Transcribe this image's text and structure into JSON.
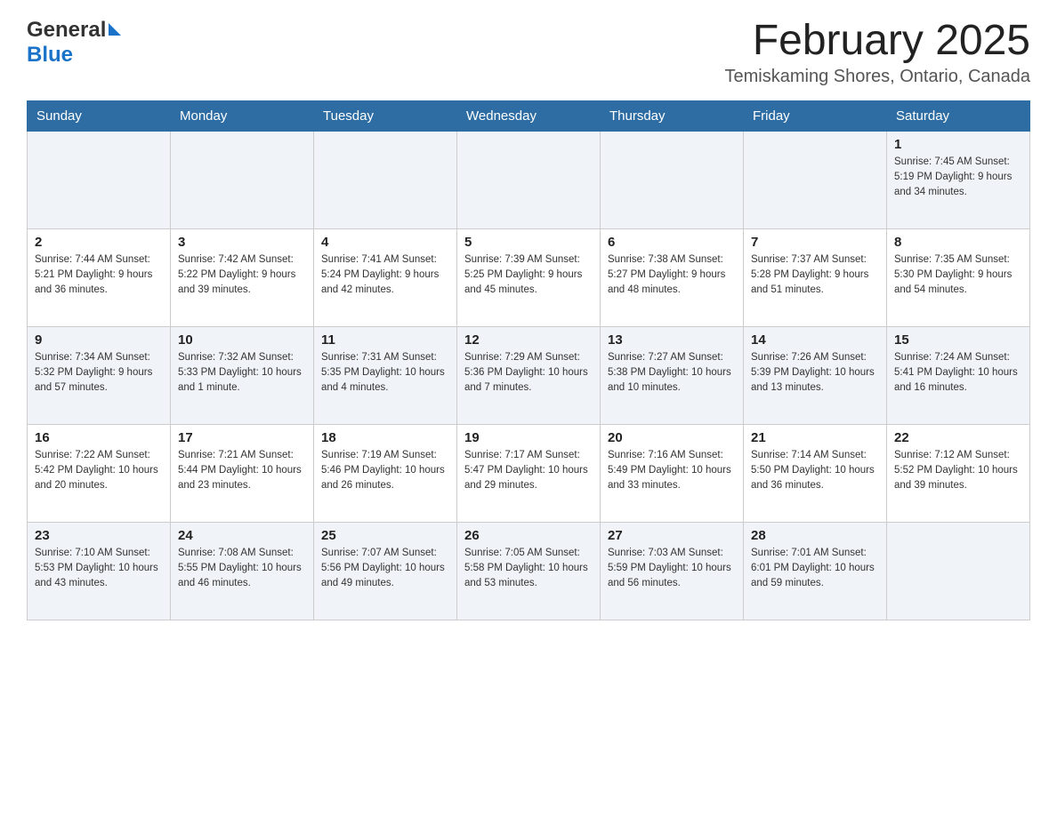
{
  "logo": {
    "text_general": "General",
    "text_blue": "Blue"
  },
  "header": {
    "month_year": "February 2025",
    "location": "Temiskaming Shores, Ontario, Canada"
  },
  "days_of_week": [
    "Sunday",
    "Monday",
    "Tuesday",
    "Wednesday",
    "Thursday",
    "Friday",
    "Saturday"
  ],
  "weeks": [
    [
      {
        "day": "",
        "info": ""
      },
      {
        "day": "",
        "info": ""
      },
      {
        "day": "",
        "info": ""
      },
      {
        "day": "",
        "info": ""
      },
      {
        "day": "",
        "info": ""
      },
      {
        "day": "",
        "info": ""
      },
      {
        "day": "1",
        "info": "Sunrise: 7:45 AM\nSunset: 5:19 PM\nDaylight: 9 hours\nand 34 minutes."
      }
    ],
    [
      {
        "day": "2",
        "info": "Sunrise: 7:44 AM\nSunset: 5:21 PM\nDaylight: 9 hours\nand 36 minutes."
      },
      {
        "day": "3",
        "info": "Sunrise: 7:42 AM\nSunset: 5:22 PM\nDaylight: 9 hours\nand 39 minutes."
      },
      {
        "day": "4",
        "info": "Sunrise: 7:41 AM\nSunset: 5:24 PM\nDaylight: 9 hours\nand 42 minutes."
      },
      {
        "day": "5",
        "info": "Sunrise: 7:39 AM\nSunset: 5:25 PM\nDaylight: 9 hours\nand 45 minutes."
      },
      {
        "day": "6",
        "info": "Sunrise: 7:38 AM\nSunset: 5:27 PM\nDaylight: 9 hours\nand 48 minutes."
      },
      {
        "day": "7",
        "info": "Sunrise: 7:37 AM\nSunset: 5:28 PM\nDaylight: 9 hours\nand 51 minutes."
      },
      {
        "day": "8",
        "info": "Sunrise: 7:35 AM\nSunset: 5:30 PM\nDaylight: 9 hours\nand 54 minutes."
      }
    ],
    [
      {
        "day": "9",
        "info": "Sunrise: 7:34 AM\nSunset: 5:32 PM\nDaylight: 9 hours\nand 57 minutes."
      },
      {
        "day": "10",
        "info": "Sunrise: 7:32 AM\nSunset: 5:33 PM\nDaylight: 10 hours\nand 1 minute."
      },
      {
        "day": "11",
        "info": "Sunrise: 7:31 AM\nSunset: 5:35 PM\nDaylight: 10 hours\nand 4 minutes."
      },
      {
        "day": "12",
        "info": "Sunrise: 7:29 AM\nSunset: 5:36 PM\nDaylight: 10 hours\nand 7 minutes."
      },
      {
        "day": "13",
        "info": "Sunrise: 7:27 AM\nSunset: 5:38 PM\nDaylight: 10 hours\nand 10 minutes."
      },
      {
        "day": "14",
        "info": "Sunrise: 7:26 AM\nSunset: 5:39 PM\nDaylight: 10 hours\nand 13 minutes."
      },
      {
        "day": "15",
        "info": "Sunrise: 7:24 AM\nSunset: 5:41 PM\nDaylight: 10 hours\nand 16 minutes."
      }
    ],
    [
      {
        "day": "16",
        "info": "Sunrise: 7:22 AM\nSunset: 5:42 PM\nDaylight: 10 hours\nand 20 minutes."
      },
      {
        "day": "17",
        "info": "Sunrise: 7:21 AM\nSunset: 5:44 PM\nDaylight: 10 hours\nand 23 minutes."
      },
      {
        "day": "18",
        "info": "Sunrise: 7:19 AM\nSunset: 5:46 PM\nDaylight: 10 hours\nand 26 minutes."
      },
      {
        "day": "19",
        "info": "Sunrise: 7:17 AM\nSunset: 5:47 PM\nDaylight: 10 hours\nand 29 minutes."
      },
      {
        "day": "20",
        "info": "Sunrise: 7:16 AM\nSunset: 5:49 PM\nDaylight: 10 hours\nand 33 minutes."
      },
      {
        "day": "21",
        "info": "Sunrise: 7:14 AM\nSunset: 5:50 PM\nDaylight: 10 hours\nand 36 minutes."
      },
      {
        "day": "22",
        "info": "Sunrise: 7:12 AM\nSunset: 5:52 PM\nDaylight: 10 hours\nand 39 minutes."
      }
    ],
    [
      {
        "day": "23",
        "info": "Sunrise: 7:10 AM\nSunset: 5:53 PM\nDaylight: 10 hours\nand 43 minutes."
      },
      {
        "day": "24",
        "info": "Sunrise: 7:08 AM\nSunset: 5:55 PM\nDaylight: 10 hours\nand 46 minutes."
      },
      {
        "day": "25",
        "info": "Sunrise: 7:07 AM\nSunset: 5:56 PM\nDaylight: 10 hours\nand 49 minutes."
      },
      {
        "day": "26",
        "info": "Sunrise: 7:05 AM\nSunset: 5:58 PM\nDaylight: 10 hours\nand 53 minutes."
      },
      {
        "day": "27",
        "info": "Sunrise: 7:03 AM\nSunset: 5:59 PM\nDaylight: 10 hours\nand 56 minutes."
      },
      {
        "day": "28",
        "info": "Sunrise: 7:01 AM\nSunset: 6:01 PM\nDaylight: 10 hours\nand 59 minutes."
      },
      {
        "day": "",
        "info": ""
      }
    ]
  ]
}
